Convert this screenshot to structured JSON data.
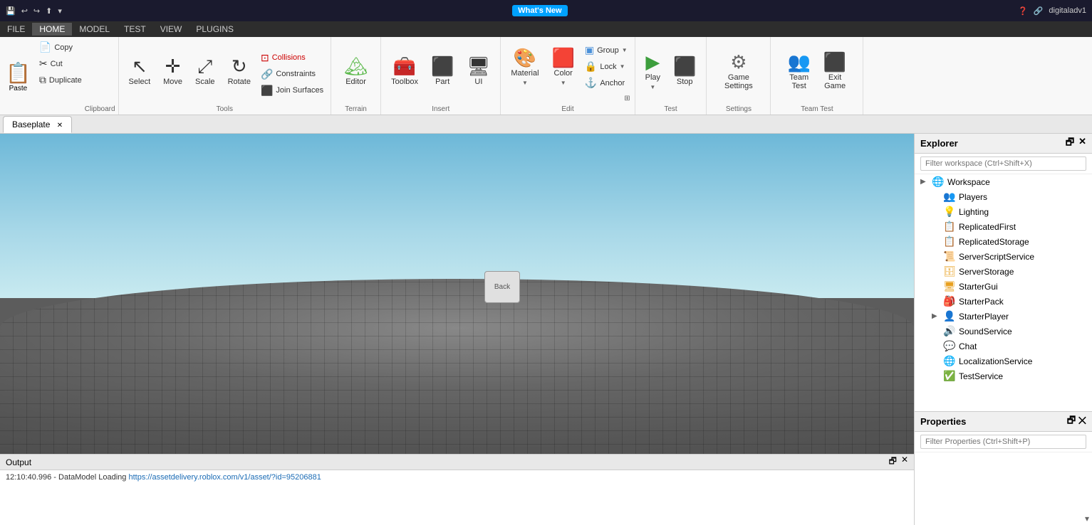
{
  "titlebar": {
    "whats_new": "What's New",
    "help_icon": "❓",
    "share_icon": "🔗",
    "user": "digitaladv1",
    "save_icon": "💾",
    "undo_icon": "↩",
    "redo_icon": "↪",
    "publish_icon": "⬆"
  },
  "menubar": {
    "items": [
      "FILE",
      "HOME",
      "MODEL",
      "TEST",
      "VIEW",
      "PLUGINS"
    ]
  },
  "ribbon": {
    "clipboard": {
      "label": "Clipboard",
      "paste": "Paste",
      "copy": "Copy",
      "cut": "Cut",
      "duplicate": "Duplicate"
    },
    "tools": {
      "label": "Tools",
      "select": "Select",
      "move": "Move",
      "scale": "Scale",
      "rotate": "Rotate",
      "collisions": "Collisions",
      "constraints": "Constraints",
      "join_surfaces": "Join Surfaces"
    },
    "terrain": {
      "label": "Terrain",
      "editor": "Editor"
    },
    "insert": {
      "label": "Insert",
      "toolbox": "Toolbox",
      "part": "Part",
      "ui": "UI"
    },
    "edit": {
      "label": "Edit",
      "material": "Material",
      "color": "Color",
      "group": "Group",
      "lock": "Lock",
      "anchor": "Anchor",
      "expand_icon": "⊞"
    },
    "test": {
      "label": "Test",
      "play": "Play",
      "stop": "Stop"
    },
    "settings": {
      "label": "Settings",
      "game_settings": "Game Settings"
    },
    "team_test": {
      "label": "Team Test",
      "team_test": "Team Test",
      "exit_game": "Exit Game"
    }
  },
  "tabs": [
    {
      "label": "Baseplate",
      "active": true
    }
  ],
  "viewport": {
    "floating_label": "Back"
  },
  "output": {
    "title": "Output",
    "log": "12:10:40.996 - DataModel Loading https://assetdelivery.roblox.com/v1/asset/?id=95206881",
    "log_url": "https://assetdelivery.roblox.com/v1/asset/?id=95206881",
    "log_prefix": "12:10:40.996 - DataModel Loading "
  },
  "explorer": {
    "title": "Explorer",
    "filter_placeholder": "Filter workspace (Ctrl+Shift+X)",
    "items": [
      {
        "name": "Workspace",
        "icon": "🌐",
        "color": "wi",
        "arrow": "▶",
        "indent": 0
      },
      {
        "name": "Players",
        "icon": "👥",
        "color": "gi",
        "arrow": "",
        "indent": 1
      },
      {
        "name": "Lighting",
        "icon": "💡",
        "color": "li",
        "arrow": "",
        "indent": 1
      },
      {
        "name": "ReplicatedFirst",
        "icon": "📋",
        "color": "ri",
        "arrow": "",
        "indent": 1
      },
      {
        "name": "ReplicatedStorage",
        "icon": "📋",
        "color": "ri",
        "arrow": "",
        "indent": 1
      },
      {
        "name": "ServerScriptService",
        "icon": "📜",
        "color": "si",
        "arrow": "",
        "indent": 1
      },
      {
        "name": "ServerStorage",
        "icon": "🗄",
        "color": "gi",
        "arrow": "",
        "indent": 1
      },
      {
        "name": "StarterGui",
        "icon": "🖥",
        "color": "gi",
        "arrow": "",
        "indent": 1
      },
      {
        "name": "StarterPack",
        "icon": "🎒",
        "color": "gi",
        "arrow": "",
        "indent": 1
      },
      {
        "name": "StarterPlayer",
        "icon": "👤",
        "color": "gi",
        "arrow": "▶",
        "indent": 1
      },
      {
        "name": "SoundService",
        "icon": "🔊",
        "color": "ci",
        "arrow": "",
        "indent": 1
      },
      {
        "name": "Chat",
        "icon": "💬",
        "color": "ci",
        "arrow": "",
        "indent": 1
      },
      {
        "name": "LocalizationService",
        "icon": "🌐",
        "color": "wi",
        "arrow": "",
        "indent": 1
      },
      {
        "name": "TestService",
        "icon": "✅",
        "color": "si",
        "arrow": "",
        "indent": 1
      }
    ]
  },
  "properties": {
    "title": "Properties",
    "filter_placeholder": "Filter Properties (Ctrl+Shift+P)"
  }
}
